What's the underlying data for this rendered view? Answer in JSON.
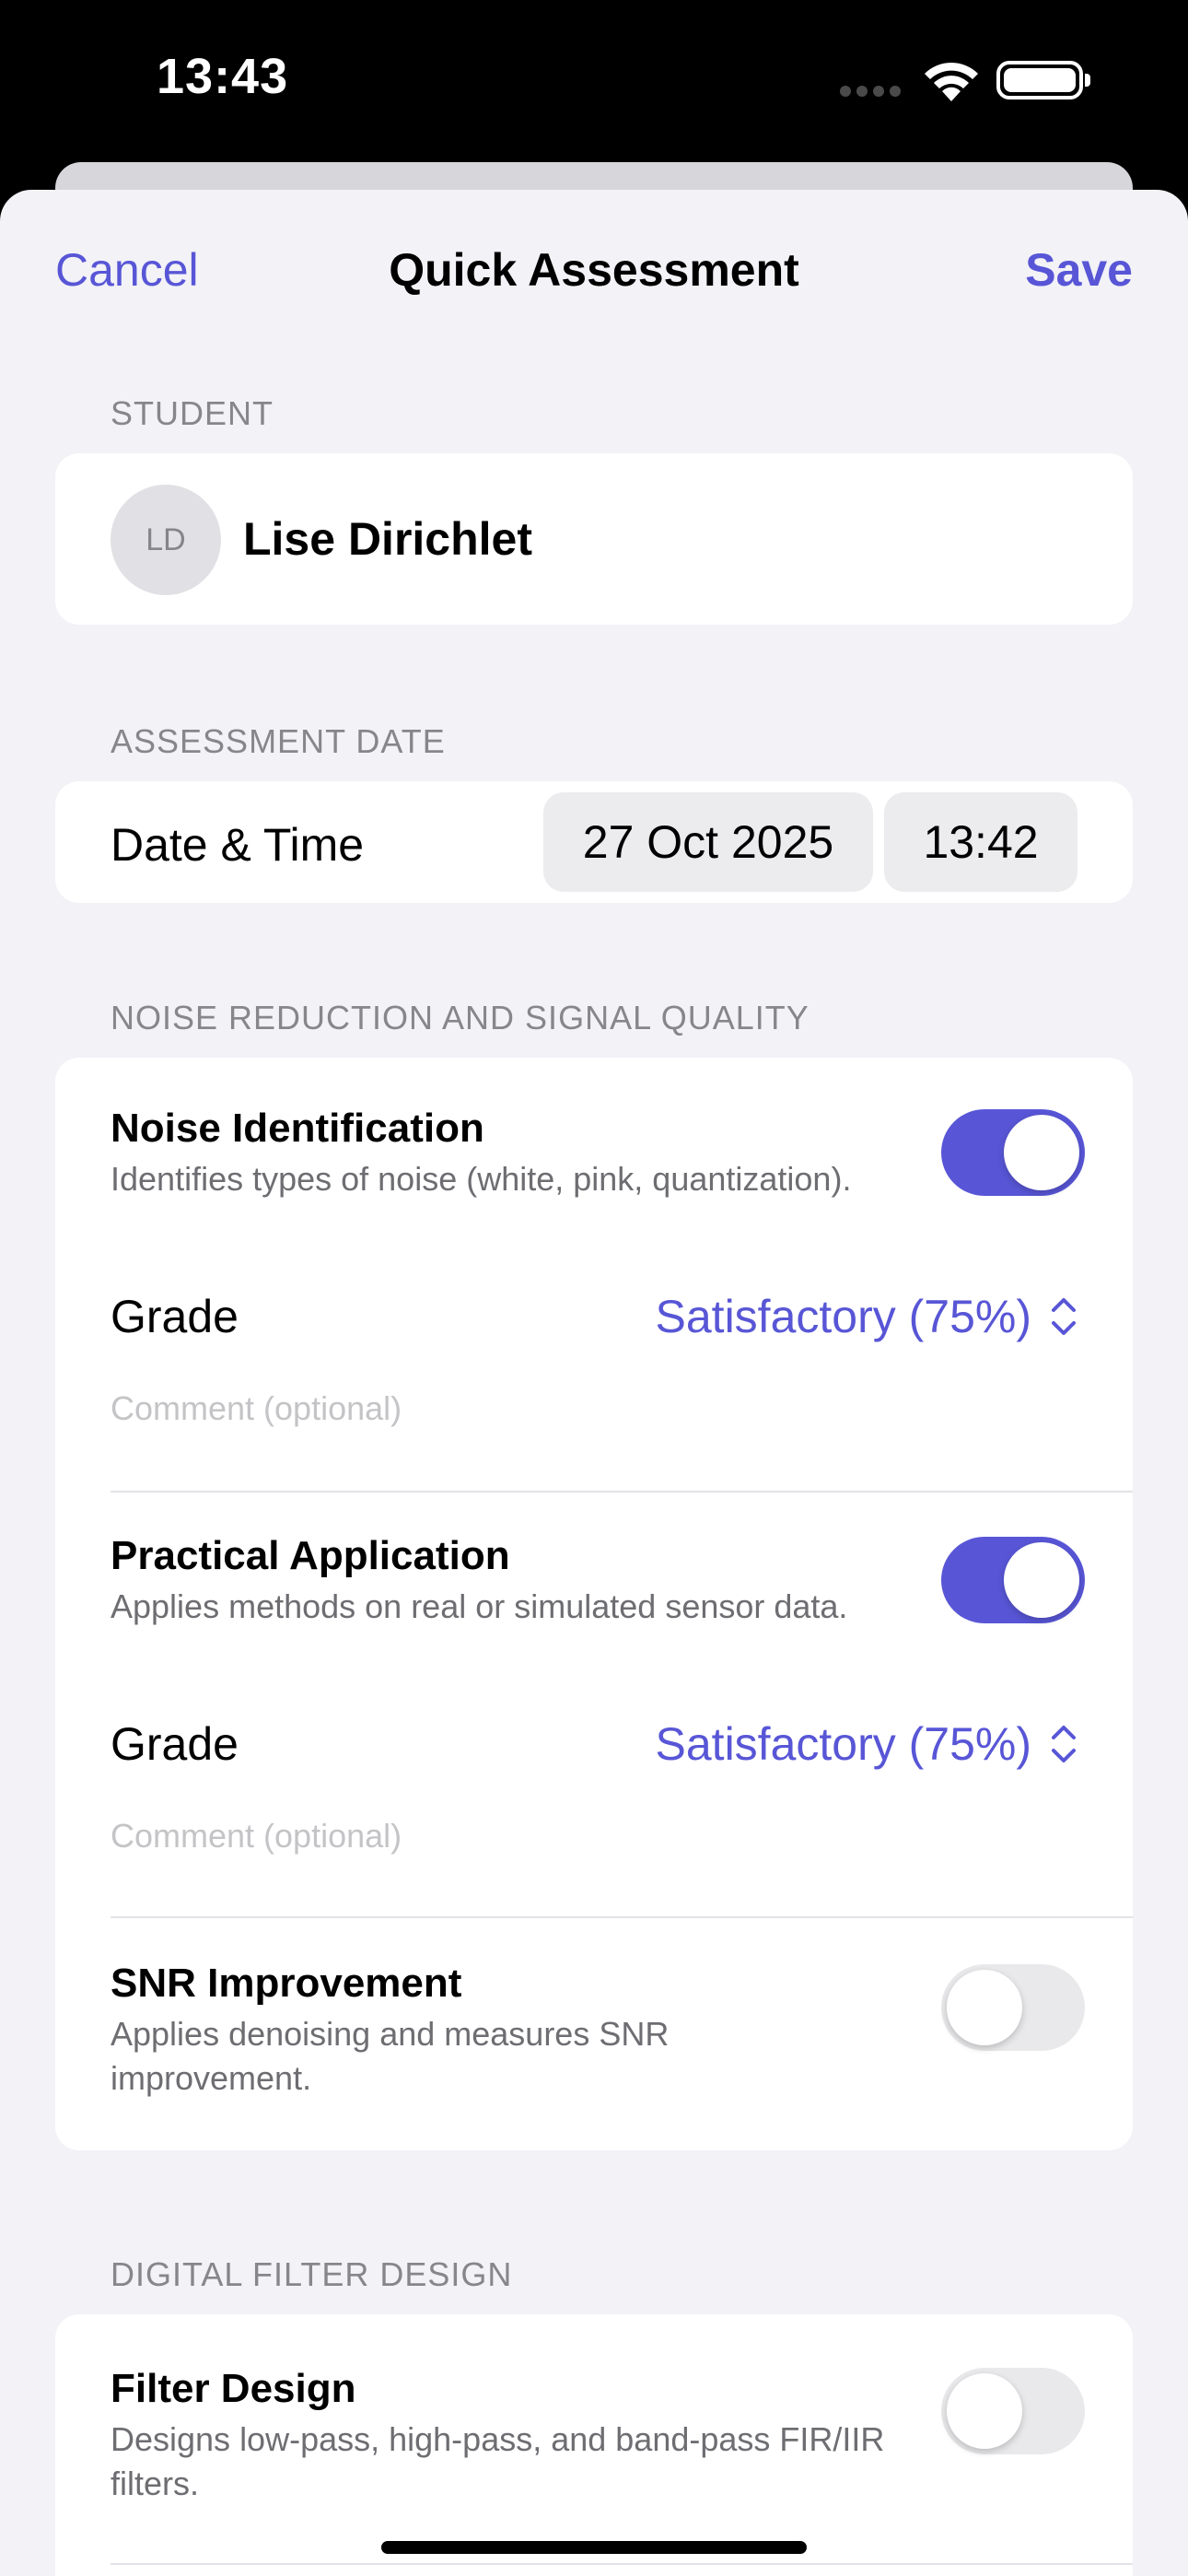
{
  "status_bar": {
    "time": "13:43"
  },
  "nav": {
    "cancel_label": "Cancel",
    "title": "Quick Assessment",
    "save_label": "Save"
  },
  "student": {
    "section_header": "STUDENT",
    "initials": "LD",
    "name": "Lise Dirichlet"
  },
  "assessment_date": {
    "section_header": "ASSESSMENT DATE",
    "label": "Date & Time",
    "date": "27 Oct 2025",
    "time": "13:42"
  },
  "noise_section": {
    "header": "NOISE REDUCTION AND SIGNAL QUALITY",
    "items": [
      {
        "title": "Noise Identification",
        "description": "Identifies types of noise (white, pink, quantization).",
        "enabled": true,
        "grade_label": "Grade",
        "grade_value": "Satisfactory (75%)",
        "comment_placeholder": "Comment (optional)"
      },
      {
        "title": "Practical Application",
        "description": "Applies methods on real or simulated sensor data.",
        "enabled": true,
        "grade_label": "Grade",
        "grade_value": "Satisfactory (75%)",
        "comment_placeholder": "Comment (optional)"
      },
      {
        "title": "SNR Improvement",
        "description": "Applies denoising and measures SNR improvement.",
        "enabled": false
      }
    ]
  },
  "filter_section": {
    "header": "DIGITAL FILTER DESIGN",
    "items": [
      {
        "title": "Filter Design",
        "description": "Designs low-pass, high-pass, and band-pass FIR/IIR filters.",
        "enabled": false
      }
    ]
  },
  "colors": {
    "accent": "#5856d6",
    "background": "#f2f2f7",
    "toggle_off": "#e9e9eb"
  }
}
